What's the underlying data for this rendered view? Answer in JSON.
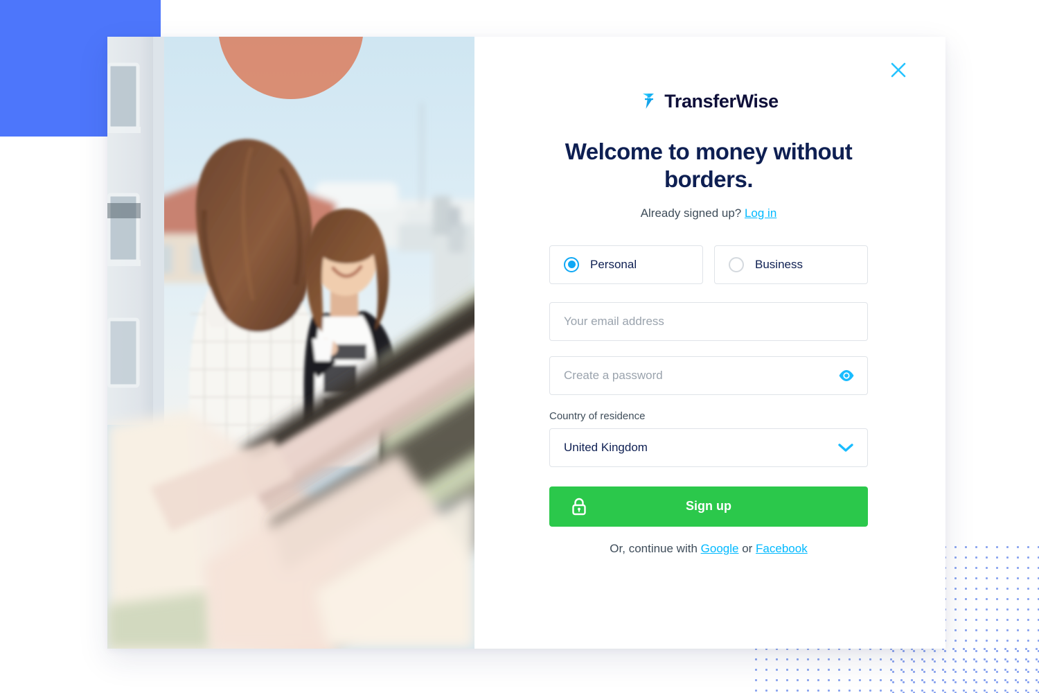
{
  "brand": {
    "name": "TransferWise",
    "logo_icon": "transferwise-flag-icon",
    "accent_blue": "#00b9ff",
    "navy": "#0e1f52",
    "green": "#2bc84b",
    "deco_blue": "#4d76fb",
    "dot_blue": "#8aa4ef"
  },
  "modal": {
    "close_icon": "close-icon",
    "close_label": "✕"
  },
  "heading": {
    "title": "Welcome to money without borders.",
    "subtitle_prefix": "Already signed up? ",
    "login_link": "Log in"
  },
  "account_type": {
    "options": [
      {
        "label": "Personal",
        "selected": true,
        "icon": "radio-selected-icon"
      },
      {
        "label": "Business",
        "selected": false,
        "icon": "radio-unselected-icon"
      }
    ]
  },
  "form": {
    "email": {
      "placeholder": "Your email address",
      "value": ""
    },
    "password": {
      "placeholder": "Create a password",
      "value": "",
      "toggle_icon": "eye-icon"
    },
    "country": {
      "label": "Country of residence",
      "value": "United Kingdom",
      "chevron_icon": "chevron-down-icon"
    },
    "submit": {
      "label": "Sign up",
      "icon": "lock-icon"
    }
  },
  "social": {
    "prefix": "Or, continue with ",
    "google": "Google",
    "separator": " or ",
    "facebook": "Facebook"
  },
  "photo": {
    "alt": "Two women talking on a rooftop balcony"
  }
}
